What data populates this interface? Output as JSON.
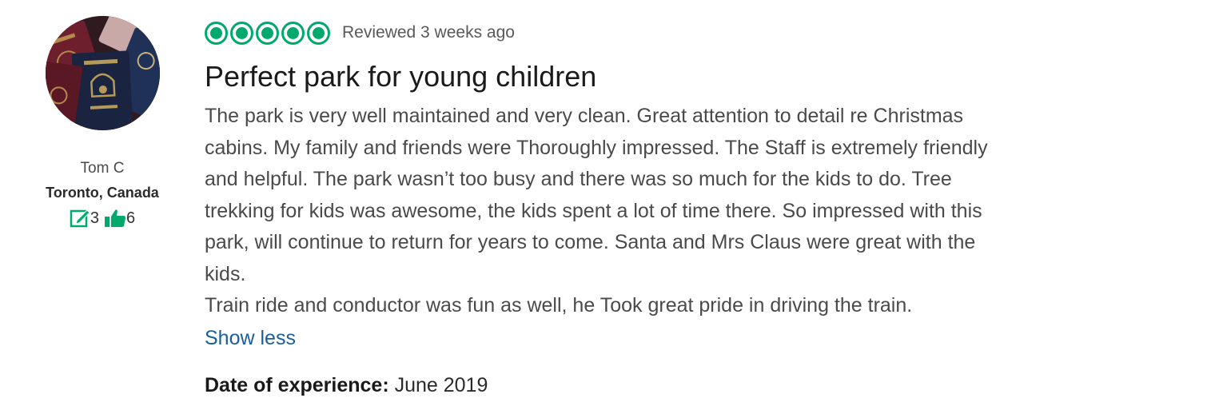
{
  "reviewer": {
    "name": "Tom C",
    "location": "Toronto, Canada",
    "reviews_count": "3",
    "helpful_votes": "6",
    "avatar_icon": "passports-photo"
  },
  "review": {
    "rating": 5,
    "rating_max": 5,
    "reviewed_text": "Reviewed 3 weeks ago",
    "title": "Perfect park for young children",
    "body_lines": [
      "The park is very well maintained and very clean. Great attention to detail re Christmas",
      "cabins. My family and friends were Thoroughly impressed. The Staff is extremely friendly",
      "and helpful. The park wasn’t too busy and there was so much for the kids to do. Tree",
      "trekking for kids was awesome, the kids spent a lot of time there. So impressed with this",
      "park, will continue to return for years to come. Santa and Mrs Claus were great with the",
      "kids.",
      "Train ride and conductor was fun as well, he Took great pride in driving the train."
    ],
    "show_less_label": "Show less",
    "experience_label": "Date of experience:",
    "experience_value": "June 2019"
  },
  "colors": {
    "bubble": "#00aa6c",
    "link": "#1a5e9c",
    "stat_icon": "#00aa6c"
  }
}
